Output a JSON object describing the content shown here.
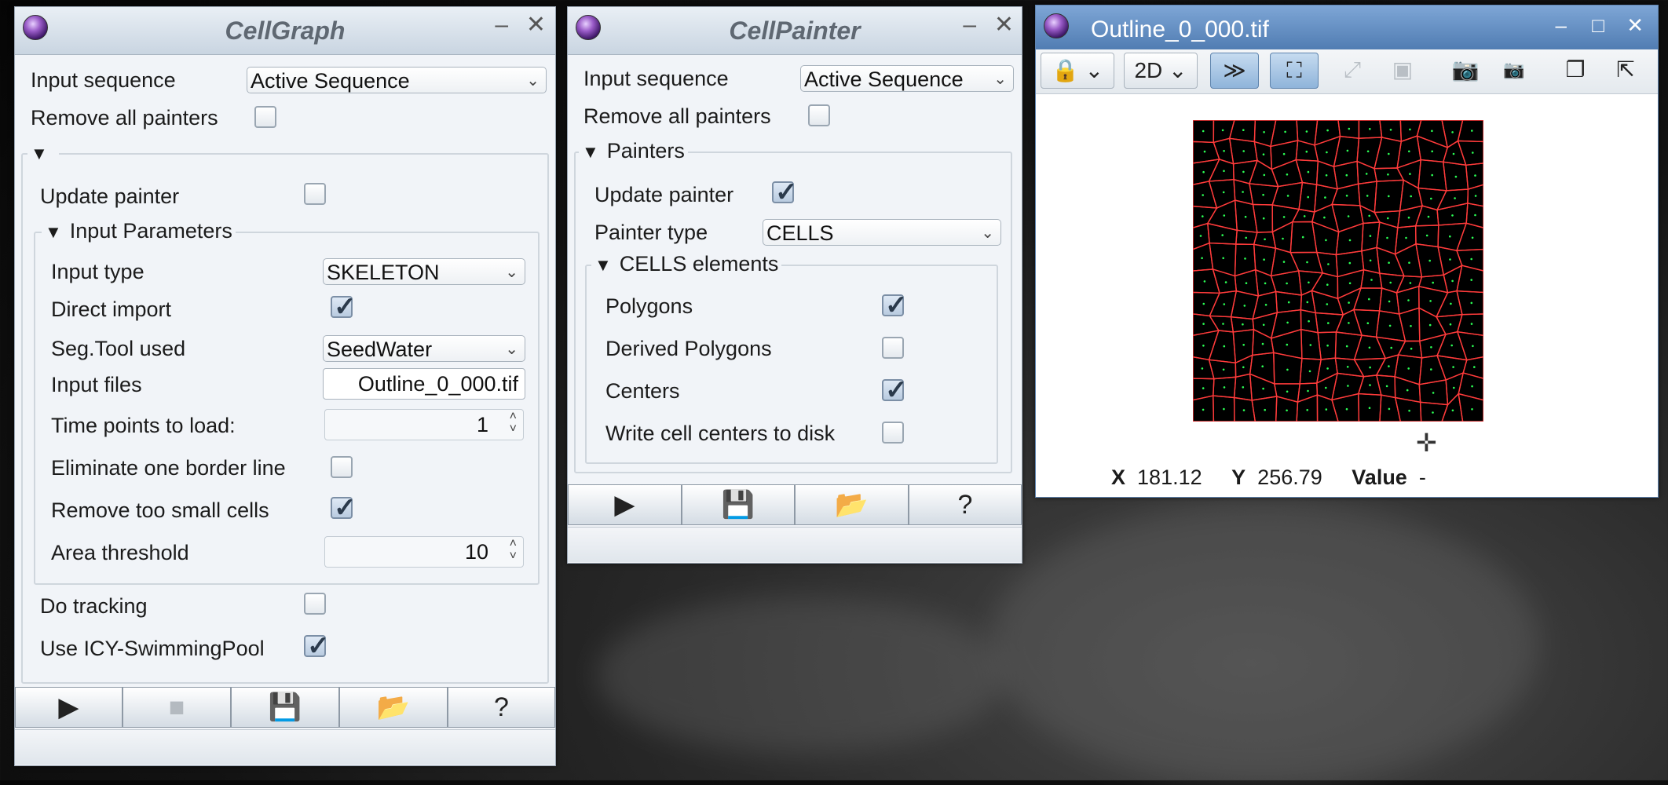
{
  "cellgraph": {
    "title": "CellGraph",
    "input_sequence_label": "Input sequence",
    "input_sequence_value": "Active Sequence",
    "remove_painters_label": "Remove all painters",
    "remove_painters_checked": false,
    "update_painter_label": "Update painter",
    "update_painter_checked": false,
    "input_params_title": "Input Parameters",
    "input_type_label": "Input type",
    "input_type_value": "SKELETON",
    "direct_import_label": "Direct import",
    "direct_import_checked": true,
    "seg_tool_label": "Seg.Tool used",
    "seg_tool_value": "SeedWater",
    "input_files_label": "Input files",
    "input_files_value": "Outline_0_000.tif",
    "time_points_label": "Time points to load:",
    "time_points_value": "1",
    "eliminate_border_label": "Eliminate one border line",
    "eliminate_border_checked": false,
    "remove_small_label": "Remove too small cells",
    "remove_small_checked": true,
    "area_threshold_label": "Area threshold",
    "area_threshold_value": "10",
    "do_tracking_label": "Do tracking",
    "do_tracking_checked": false,
    "swimming_pool_label": "Use ICY-SwimmingPool",
    "swimming_pool_checked": true
  },
  "cellpainter": {
    "title": "CellPainter",
    "input_sequence_label": "Input sequence",
    "input_sequence_value": "Active Sequence",
    "remove_painters_label": "Remove all painters",
    "remove_painters_checked": false,
    "painters_title": "Painters",
    "update_painter_label": "Update painter",
    "update_painter_checked": true,
    "painter_type_label": "Painter type",
    "painter_type_value": "CELLS",
    "cells_elements_title": "CELLS elements",
    "polygons_label": "Polygons",
    "polygons_checked": true,
    "derived_polygons_label": "Derived Polygons",
    "derived_polygons_checked": false,
    "centers_label": "Centers",
    "centers_checked": true,
    "write_centers_label": "Write cell centers to disk",
    "write_centers_checked": false
  },
  "viewer": {
    "title": "Outline_0_000.tif",
    "mode_2d": "2D",
    "readout": {
      "x_label": "X",
      "x_value": "181.12",
      "y_label": "Y",
      "y_value": "256.79",
      "value_label": "Value",
      "value_value": "-"
    }
  },
  "glyphs": {
    "tri": "▼",
    "check": "✓",
    "arrow": "⌄",
    "minimize": "–",
    "close": "✕",
    "maximize": "□",
    "play": "▶",
    "stop": "■",
    "save": "💾",
    "open": "📂",
    "help": "?",
    "lock": "🔒",
    "camera": "📷",
    "crosshair": "✛",
    "spin_up": "˄",
    "spin_down": "˅"
  }
}
